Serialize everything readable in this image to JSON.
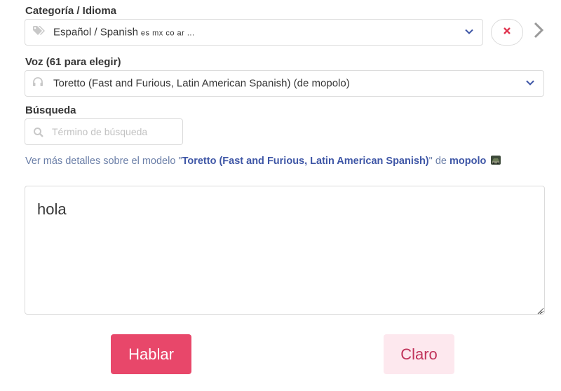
{
  "category": {
    "label": "Categoría / Idioma",
    "selected": "Español / Spanish",
    "tags": "es mx co ar ..."
  },
  "voice": {
    "label": "Voz (61 para elegir)",
    "selected": "Toretto (Fast and Furious, Latin American Spanish) (de mopolo)"
  },
  "search": {
    "label": "Búsqueda",
    "placeholder": "Término de búsqueda"
  },
  "details": {
    "prefix": "Ver más detalles sobre el modelo \"",
    "model": "Toretto (Fast and Furious, Latin American Spanish)",
    "middle": "\" de ",
    "author": "mopolo"
  },
  "input_text": "hola",
  "buttons": {
    "speak": "Hablar",
    "clear": "Claro"
  },
  "colors": {
    "primary": "#e8476a",
    "link": "#3e56a6",
    "clear_x": "#e0344f"
  },
  "icons": {
    "category": "tags-icon",
    "voice": "headphones-icon",
    "search": "search-icon",
    "clear": "close-icon",
    "next": "chevron-right-icon",
    "dropdown": "chevron-down-icon"
  }
}
